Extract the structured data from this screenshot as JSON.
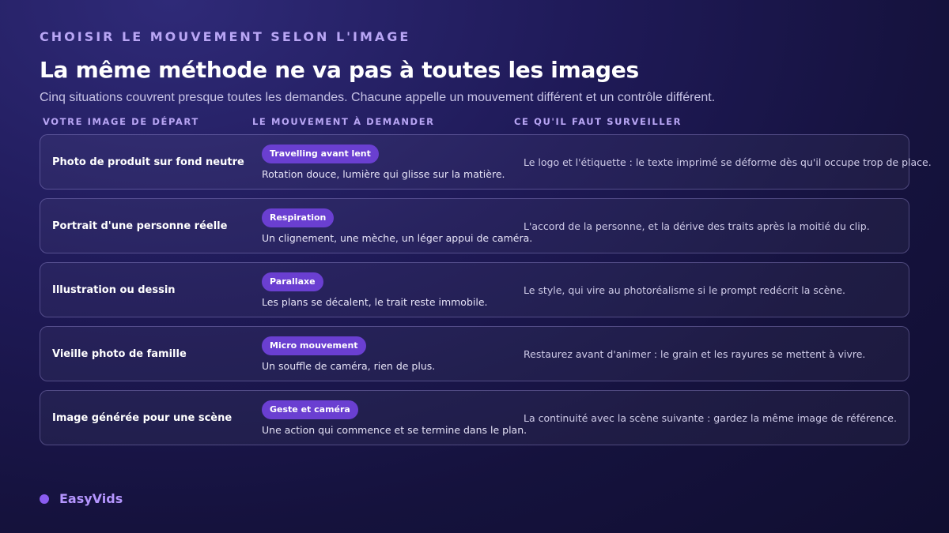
{
  "header": {
    "eyebrow": "CHOISIR LE MOUVEMENT SELON L'IMAGE",
    "title": "La même méthode ne va pas à toutes les images",
    "subtitle": "Cinq situations couvrent presque toutes les demandes. Chacune appelle un mouvement différent et un contrôle différent."
  },
  "columns": {
    "image": "VOTRE IMAGE DE DÉPART",
    "movement": "LE MOUVEMENT À DEMANDER",
    "watch": "CE QU'IL FAUT SURVEILLER"
  },
  "rows": [
    {
      "image": "Photo de produit sur fond neutre",
      "badge": "Travelling avant lent",
      "movement": "Rotation douce, lumière qui glisse sur la matière.",
      "watch": "Le logo et l'étiquette : le texte imprimé se déforme dès qu'il occupe trop de place."
    },
    {
      "image": "Portrait d'une personne réelle",
      "badge": "Respiration",
      "movement": "Un clignement, une mèche, un léger appui de caméra.",
      "watch": "L'accord de la personne, et la dérive des traits après la moitié du clip."
    },
    {
      "image": "Illustration ou dessin",
      "badge": "Parallaxe",
      "movement": "Les plans se décalent, le trait reste immobile.",
      "watch": "Le style, qui vire au photoréalisme si le prompt redécrit la scène."
    },
    {
      "image": "Vieille photo de famille",
      "badge": "Micro mouvement",
      "movement": "Un souffle de caméra, rien de plus.",
      "watch": "Restaurez avant d'animer : le grain et les rayures se mettent à vivre."
    },
    {
      "image": "Image générée pour une scène",
      "badge": "Geste et caméra",
      "movement": "Une action qui commence et se termine dans le plan.",
      "watch": "La continuité avec la scène suivante : gardez la même image de référence."
    }
  ],
  "brand": {
    "name": "EasyVids",
    "dot_color": "#8a5cf0"
  },
  "colors": {
    "accent": "#b9a6f5",
    "badge": "#6a3fd1",
    "background": "#1a1650"
  }
}
